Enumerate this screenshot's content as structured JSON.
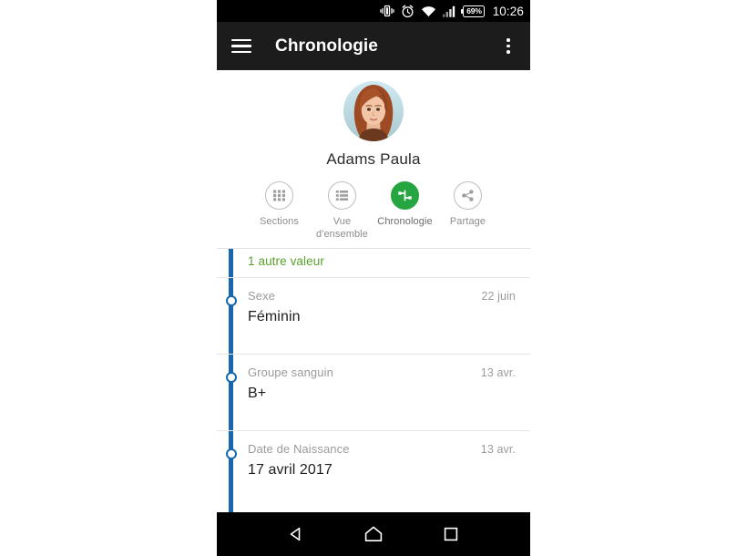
{
  "status_bar": {
    "icons": [
      "vibrate-icon",
      "alarm-icon",
      "wifi-icon",
      "signal-icon"
    ],
    "battery_percent": "69%",
    "clock": "10:26"
  },
  "app_bar": {
    "menu_icon": "hamburger-menu-icon",
    "title": "Chronologie",
    "overflow_icon": "overflow-menu-icon"
  },
  "profile": {
    "avatar_icon": "user-avatar-photo",
    "name": "Adams Paula"
  },
  "actions": [
    {
      "label": "Sections",
      "icon": "grid-icon",
      "active": false
    },
    {
      "label": "Vue d'ensemble",
      "icon": "list-icon",
      "active": false
    },
    {
      "label": "Chronologie",
      "icon": "timeline-icon",
      "active": true
    },
    {
      "label": "Partage",
      "icon": "share-icon",
      "active": false
    }
  ],
  "timeline": {
    "rail_color": "#1767b0",
    "partial_item": {
      "extra": "1 autre valeur"
    },
    "items": [
      {
        "label": "Sexe",
        "value": "Féminin",
        "date": "22 juin"
      },
      {
        "label": "Groupe sanguin",
        "value": "B+",
        "date": "13 avr."
      },
      {
        "label": "Date de Naissance",
        "value": "17 avril 2017",
        "date": "13 avr."
      }
    ]
  },
  "nav_bar": {
    "back_icon": "back-triangle-icon",
    "home_icon": "home-icon",
    "recents_icon": "recents-square-icon"
  },
  "colors": {
    "accent_green": "#26a540",
    "timeline_blue": "#1767b0",
    "extra_green": "#5aa02c",
    "app_bar": "#1c1c1c"
  }
}
